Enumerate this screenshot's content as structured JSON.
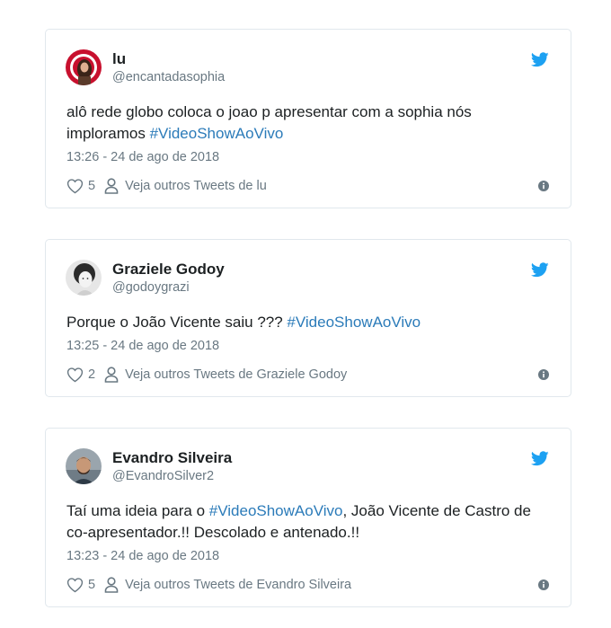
{
  "tweets": [
    {
      "name": "lu",
      "handle": "@encantadasophia",
      "text_parts": [
        "alô rede globo coloca o joao p apresentar com a sophia nós imploramos ",
        "#VideoShowAoVivo",
        ""
      ],
      "date": "13:26 - 24 de ago de 2018",
      "likes": "5",
      "see_more": "Veja outros Tweets de lu"
    },
    {
      "name": "Graziele Godoy",
      "handle": "@godoygrazi",
      "text_parts": [
        "Porque o João Vicente saiu ??? ",
        "#VideoShowAoVivo",
        ""
      ],
      "date": "13:25 - 24 de ago de 2018",
      "likes": "2",
      "see_more": "Veja outros Tweets de Graziele Godoy"
    },
    {
      "name": "Evandro Silveira",
      "handle": "@EvandroSilver2",
      "text_parts": [
        "Taí uma ideia para o ",
        "#VideoShowAoVivo",
        ", João Vicente de Castro de co-apresentador.!! Descolado e antenado.!!"
      ],
      "date": "13:23 - 24 de ago de 2018",
      "likes": "5",
      "see_more": "Veja outros Tweets de Evandro Silveira"
    }
  ],
  "colors": {
    "twitter_blue": "#1da1f2",
    "hashtag": "#2b7bb9",
    "muted": "#697882",
    "border": "#e1e8ed"
  },
  "icons": [
    "twitter-bird-icon",
    "heart-icon",
    "person-icon",
    "info-icon"
  ]
}
